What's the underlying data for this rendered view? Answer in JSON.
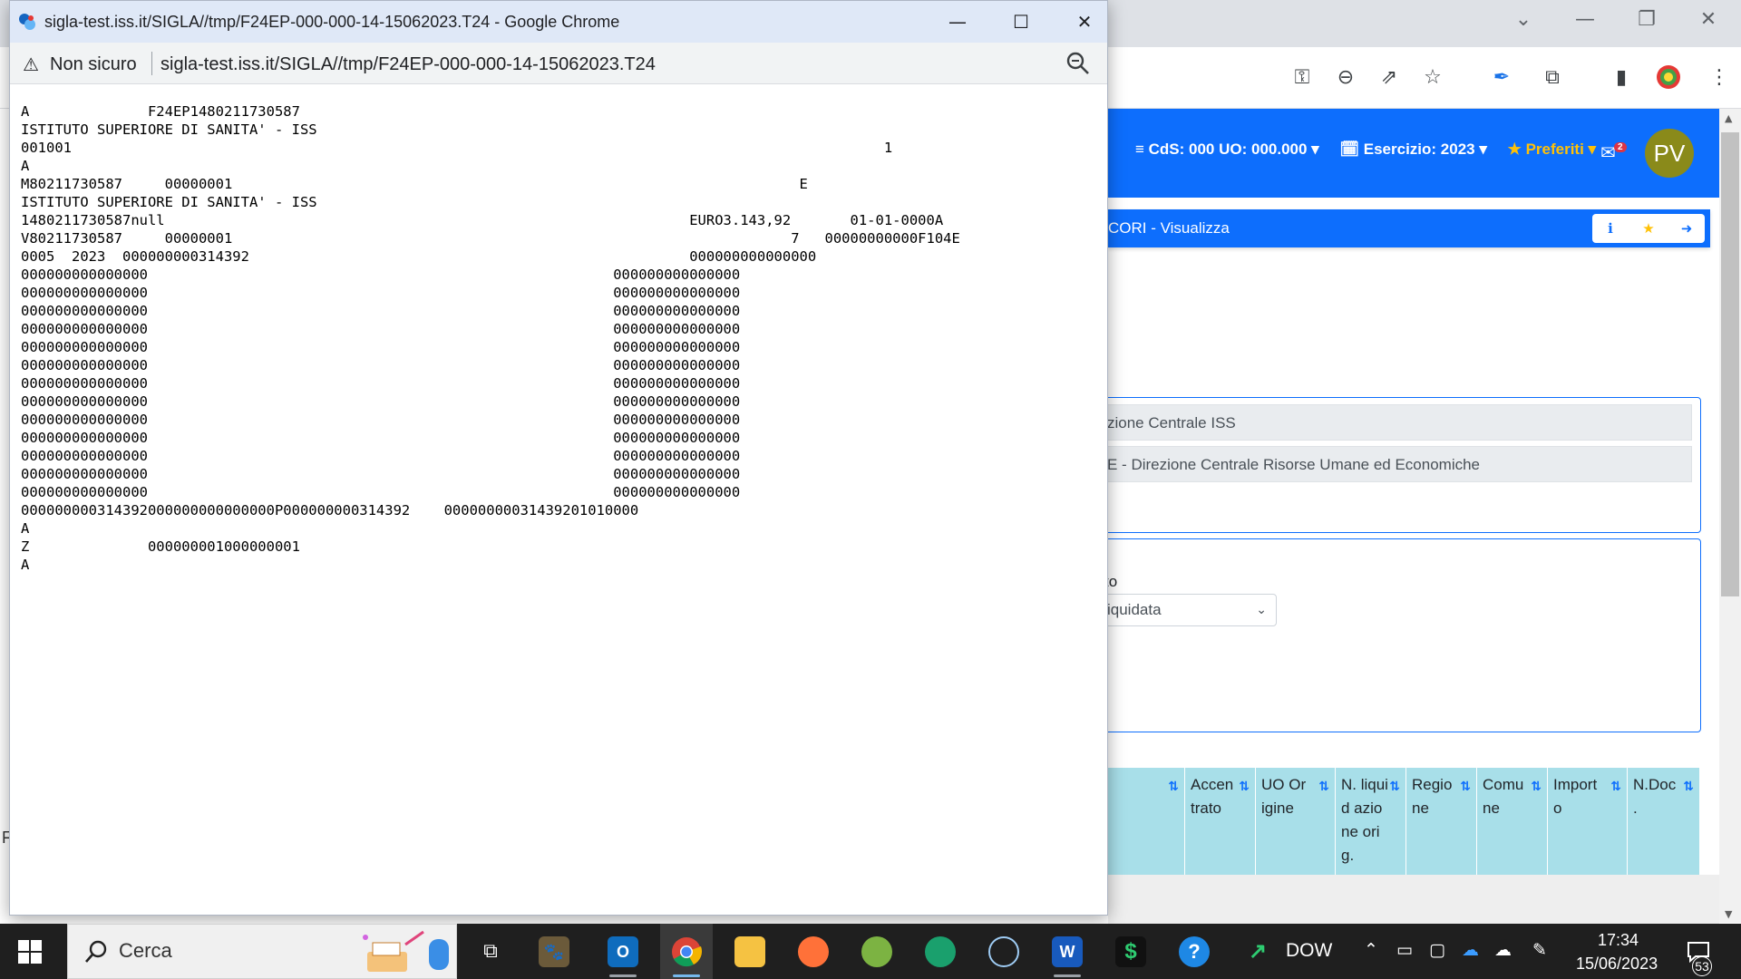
{
  "background_browser": {
    "app_header": {
      "menu": [
        "≡ CdS: 000 UO: 000.000 ▾",
        "🗓 Esercizio: 2023 ▾",
        "★ Preferiti ▾"
      ],
      "mail_badge": "2",
      "avatar_initials": "PV"
    },
    "page_title": "CORI - Visualizza",
    "fields": [
      "zione  Centrale ISS",
      "E - Direzione Centrale Risorse Umane ed Economiche"
    ],
    "sub_label": "to",
    "select_value": "iquidata",
    "table_headers": [
      "Accen trato",
      "UO Origine",
      "N. liquid azione orig.",
      "Regio ne",
      "Comu ne",
      "Import o",
      "N.Doc ."
    ],
    "left_glyph": "F"
  },
  "popup": {
    "title": "sigla-test.iss.it/SIGLA//tmp/F24EP-000-000-14-15062023.T24 - Google Chrome",
    "security_label": "Non sicuro",
    "url": "sigla-test.iss.it/SIGLA//tmp/F24EP-000-000-14-15062023.T24",
    "lines": [
      "A              F24EP1480211730587",
      "ISTITUTO SUPERIORE DI SANITA' - ISS",
      "001001                                                                                                1",
      "A",
      "M80211730587     00000001                                                                   E",
      "ISTITUTO SUPERIORE DI SANITA' - ISS",
      "1480211730587null                                                              EURO3.143,92       01-01-0000A",
      "V80211730587     00000001                                                                  7   00000000000F104E",
      "0005  2023  000000000314392                                                    000000000000000",
      "000000000000000                                                       000000000000000",
      "000000000000000                                                       000000000000000",
      "000000000000000                                                       000000000000000",
      "000000000000000                                                       000000000000000",
      "000000000000000                                                       000000000000000",
      "000000000000000                                                       000000000000000",
      "000000000000000                                                       000000000000000",
      "000000000000000                                                       000000000000000",
      "000000000000000                                                       000000000000000",
      "000000000000000                                                       000000000000000",
      "000000000000000                                                       000000000000000",
      "000000000000000                                                       000000000000000",
      "000000000000000                                                       000000000000000",
      "000000000314392000000000000000P000000000314392    00000000031439201010000",
      "A",
      "Z              000000001000000001",
      "A"
    ]
  },
  "taskbar": {
    "search_placeholder": "Cerca",
    "dow_label": "DOW",
    "time": "17:34",
    "date": "15/06/2023",
    "notification_count": "53"
  }
}
